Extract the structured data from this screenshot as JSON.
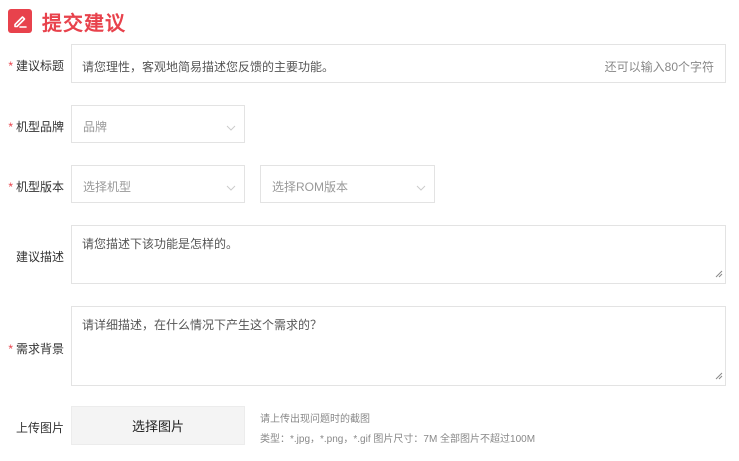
{
  "header": {
    "title": "提交建议",
    "icon": "edit-icon",
    "accent": "#e8424c"
  },
  "form": {
    "title_field": {
      "label": "建议标题",
      "required": "*",
      "placeholder": "请您理性，客观地简易描述您反馈的主要功能。",
      "counter": "还可以输入80个字符"
    },
    "brand": {
      "label": "机型品牌",
      "required": "*",
      "selected": "品牌"
    },
    "version": {
      "label": "机型版本",
      "required": "*",
      "model_placeholder": "选择机型",
      "rom_placeholder": "选择ROM版本"
    },
    "description": {
      "label": "建议描述",
      "placeholder": "请您描述下该功能是怎样的。"
    },
    "background": {
      "label": "需求背景",
      "required": "*",
      "placeholder": "请详细描述，在什么情况下产生这个需求的？"
    },
    "upload": {
      "label": "上传图片",
      "button": "选择图片",
      "hint_line1": "请上传出现问题时的截图",
      "hint_line2": "类型：*.jpg，*.png，*.gif 图片尺寸：7M 全部图片不超过100M"
    }
  }
}
